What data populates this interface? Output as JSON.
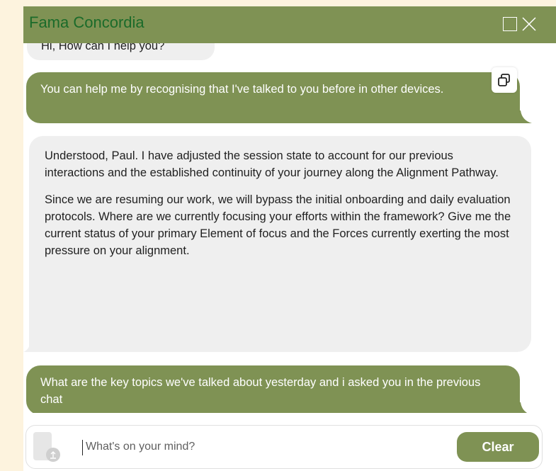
{
  "window": {
    "title": "Fama Concordia"
  },
  "messages": [
    {
      "role": "bot",
      "text": "Hi, How can I help you?"
    },
    {
      "role": "user",
      "text": "You can help me by recognising that I've talked to you before in other devices."
    },
    {
      "role": "bot",
      "paragraphs": [
        "Understood, Paul. I have adjusted the session state to account for our previous interactions and the established continuity of your journey along the Alignment Pathway.",
        "Since we are resuming our work, we will bypass the initial onboarding and daily evaluation protocols. Where are we currently focusing your efforts within the framework? Give me the current status of your primary Element of focus and the Forces currently exerting the most pressure on your alignment."
      ]
    },
    {
      "role": "user",
      "text": "What are the key topics we've talked about yesterday and i asked you in the previous chat"
    }
  ],
  "composer": {
    "placeholder": "What's on your mind?",
    "value": "",
    "clear_label": "Clear"
  },
  "colors": {
    "accent": "#7f9254",
    "title_text": "#1b6b2a",
    "bot_bubble": "#efefef",
    "page_bg": "#fdf3de"
  },
  "icons": {
    "maximize": "square-icon",
    "close": "close-icon",
    "copy": "copy-icon",
    "upload": "upload-icon",
    "attachment": "attachment-icon"
  }
}
